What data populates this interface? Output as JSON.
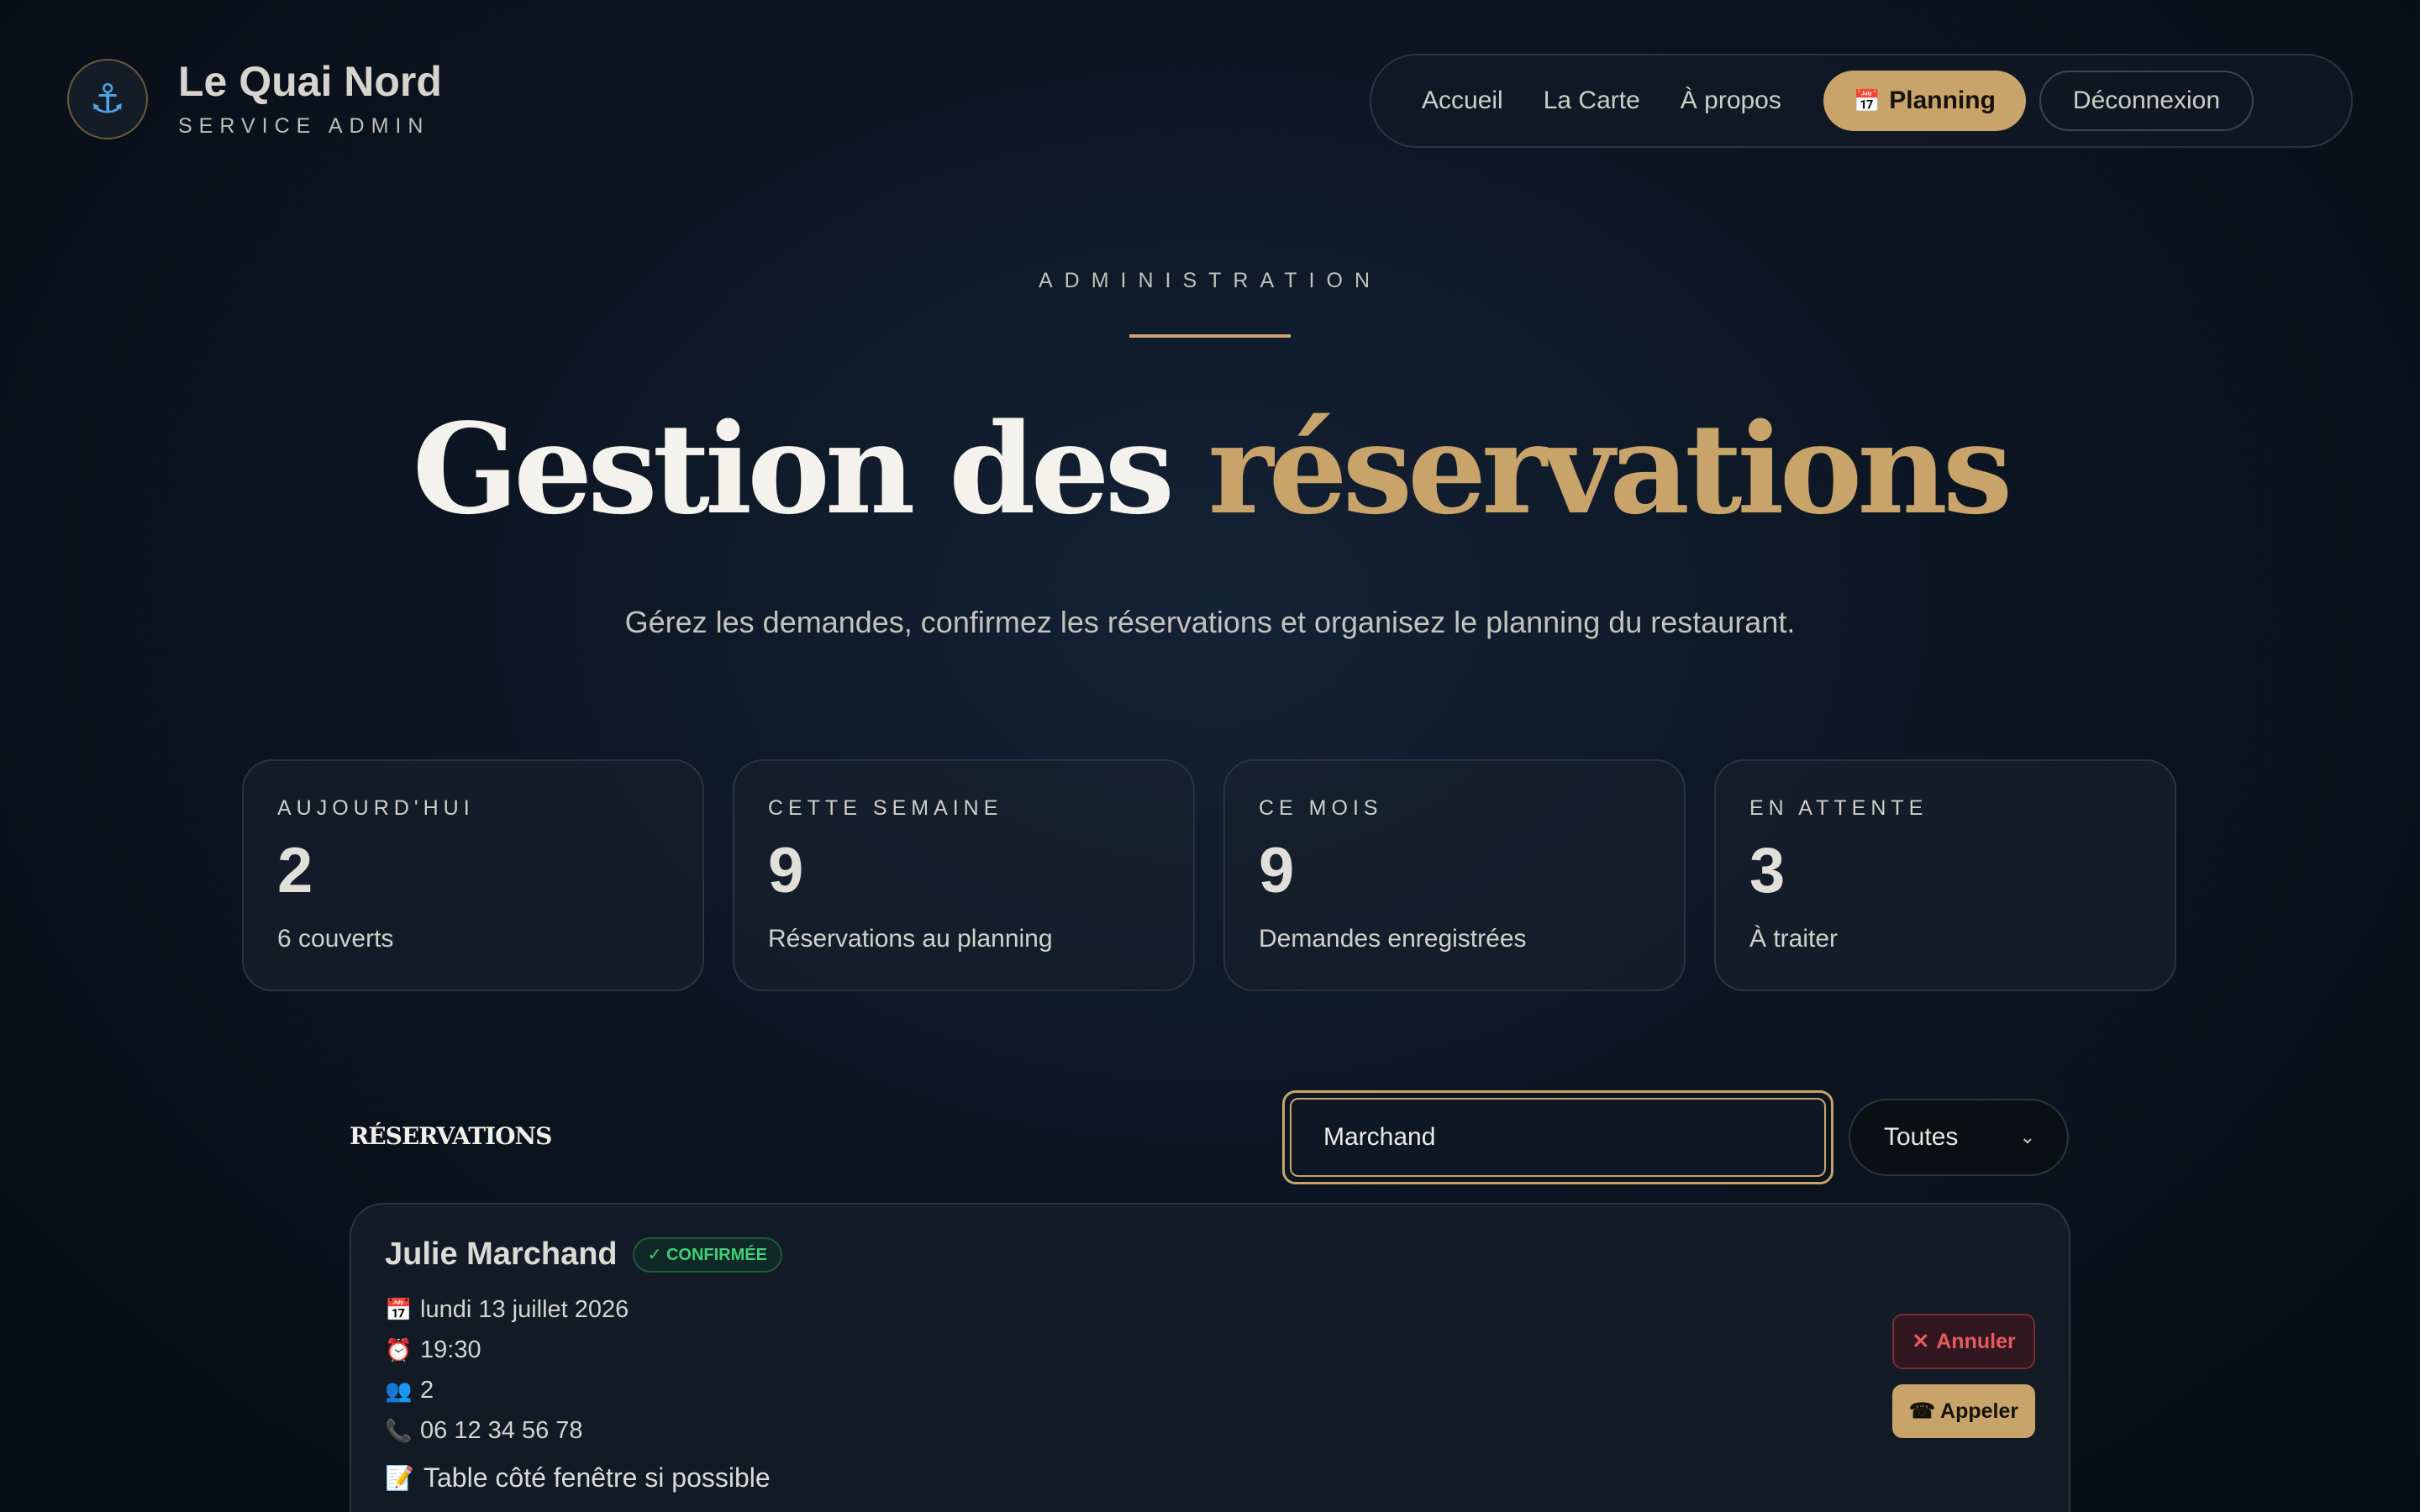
{
  "brand": {
    "logo_icon": "⚓",
    "name": "Le Quai Nord",
    "subtitle": "SERVICE ADMIN"
  },
  "nav": {
    "items": [
      "Accueil",
      "La Carte",
      "À propos"
    ],
    "active_icon": "📅",
    "active_label": "Planning",
    "logout_label": "Déconnexion"
  },
  "hero": {
    "eyebrow": "ADMINISTRATION",
    "title_main": "Gestion des ",
    "title_accent": "réservations",
    "subtitle": "Gérez les demandes, confirmez les réservations et organisez le planning du restaurant."
  },
  "stats": [
    {
      "label": "AUJOURD'HUI",
      "value": "2",
      "desc": "6 couverts"
    },
    {
      "label": "CETTE SEMAINE",
      "value": "9",
      "desc": "Réservations au planning"
    },
    {
      "label": "CE MOIS",
      "value": "9",
      "desc": "Demandes enregistrées"
    },
    {
      "label": "EN ATTENTE",
      "value": "3",
      "desc": "À traiter"
    }
  ],
  "reservations": {
    "title": "RÉSERVATIONS",
    "search_value": "Marchand",
    "filter_selected": "Toutes",
    "chevron": "⌄",
    "items": [
      {
        "name": "Julie Marchand",
        "status": "✓ CONFIRMÉE",
        "date_icon": "📅",
        "date": "lundi 13 juillet 2026",
        "time_icon": "⏰",
        "time": "19:30",
        "guests_icon": "👥",
        "guests": "2",
        "phone_icon": "📞",
        "phone": "06 12 34 56 78",
        "note_icon": "📝",
        "note": "Table côté fenêtre si possible",
        "cancel_icon": "✕",
        "cancel_label": "Annuler",
        "call_icon": "☎",
        "call_label": "Appeler"
      }
    ]
  },
  "colors": {
    "accent": "#c9a46a",
    "confirmed": "#3fcf7a",
    "danger": "#e85a60"
  }
}
